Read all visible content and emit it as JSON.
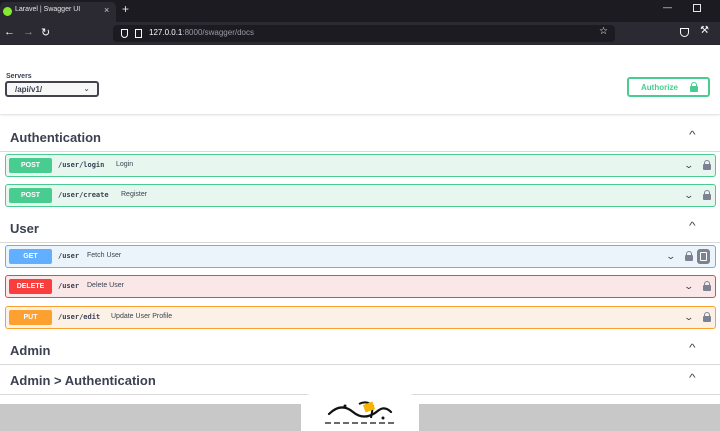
{
  "browser": {
    "tab_title": "Laravel | Swagger UI",
    "tab_close": "×",
    "new_tab": "+",
    "url_host": "127.0.0.1",
    "url_rest": ":8000/swagger/docs",
    "icons": [
      "swagger-favicon",
      "back-arrow-icon",
      "forward-arrow-icon",
      "reload-icon",
      "shield-icon",
      "page-icon",
      "star-icon",
      "pocket-icon",
      "tools-icon",
      "minimize-icon",
      "maximize-icon"
    ]
  },
  "servers": {
    "label": "Servers",
    "selected": "/api/v1/"
  },
  "authorize": {
    "label": "Authorize"
  },
  "tags": [
    {
      "title": "Authentication",
      "operations": [
        {
          "method": "POST",
          "path": "/user/login",
          "summary": "Login"
        },
        {
          "method": "POST",
          "path": "/user/create",
          "summary": "Register"
        }
      ]
    },
    {
      "title": "User",
      "operations": [
        {
          "method": "GET",
          "path": "/user",
          "summary": "Fetch User"
        },
        {
          "method": "DELETE",
          "path": "/user",
          "summary": "Delete User"
        },
        {
          "method": "PUT",
          "path": "/user/edit",
          "summary": "Update User Profile"
        }
      ]
    },
    {
      "title": "Admin"
    },
    {
      "title": "Admin > Authentication"
    }
  ],
  "colors": {
    "post": "#49cc90",
    "get": "#61affe",
    "delete": "#f93e3e",
    "put": "#fca130",
    "text": "#3b4151"
  }
}
